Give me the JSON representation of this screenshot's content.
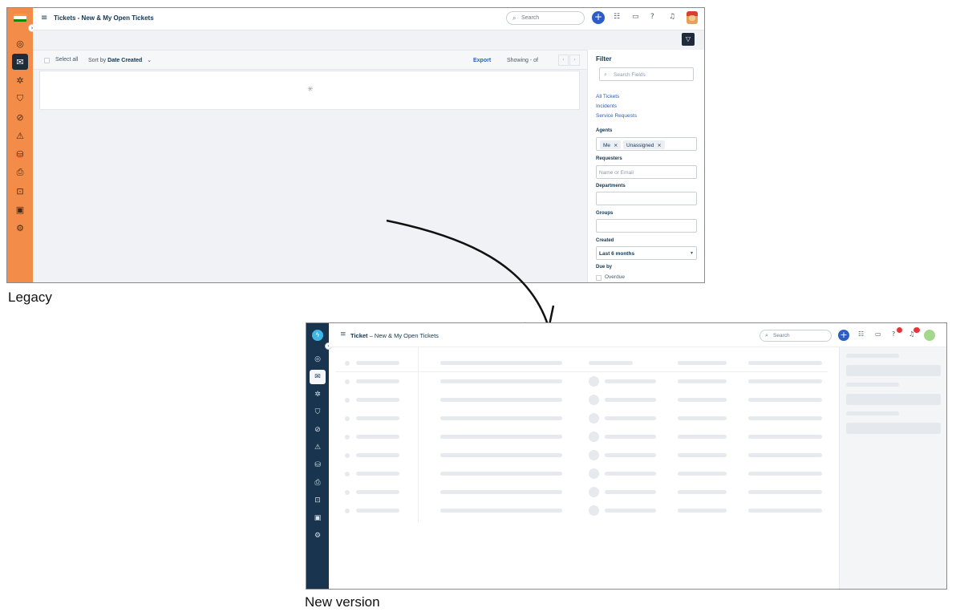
{
  "legacy": {
    "caption": "Legacy",
    "header": {
      "title": "Tickets - New & My Open Tickets",
      "search_placeholder": "Search"
    },
    "list_toolbar": {
      "select_all": "Select all",
      "sort_by_prefix": "Sort by",
      "sort_by_value": "Date Created",
      "export": "Export",
      "showing": "Showing - of"
    },
    "sidebar_icons": [
      "dashboard-icon",
      "tickets-icon",
      "problems-icon",
      "changes-icon",
      "releases-icon",
      "alerts-icon",
      "assets-icon",
      "contracts-icon",
      "solutions-icon",
      "reports-icon",
      "admin-icon"
    ],
    "filter": {
      "title": "Filter",
      "search_placeholder": "Search Fields",
      "links": [
        "All Tickets",
        "Incidents",
        "Service Requests"
      ],
      "agents_label": "Agents",
      "agents_chips": [
        "Me",
        "Unassigned"
      ],
      "requesters_label": "Requesters",
      "requesters_placeholder": "Name or Email",
      "departments_label": "Departments",
      "groups_label": "Groups",
      "created_label": "Created",
      "created_value": "Last 6 months",
      "due_by_label": "Due by",
      "overdue_label": "Overdue"
    },
    "colors": {
      "sidebar": "#f28c48",
      "accent": "#2c5cc5"
    }
  },
  "new_version": {
    "caption": "New version",
    "header": {
      "title_prefix": "Ticket",
      "title_rest": "New & My Open Tickets",
      "search_placeholder": "Search"
    },
    "sidebar_icons": [
      "dashboard-icon",
      "tickets-icon",
      "problems-icon",
      "changes-icon",
      "releases-icon",
      "alerts-icon",
      "assets-icon",
      "contracts-icon",
      "solutions-icon",
      "reports-icon",
      "admin-icon"
    ],
    "skeleton_row_count": 9,
    "colors": {
      "sidebar": "#18344e",
      "accent": "#2c5cc5"
    }
  }
}
